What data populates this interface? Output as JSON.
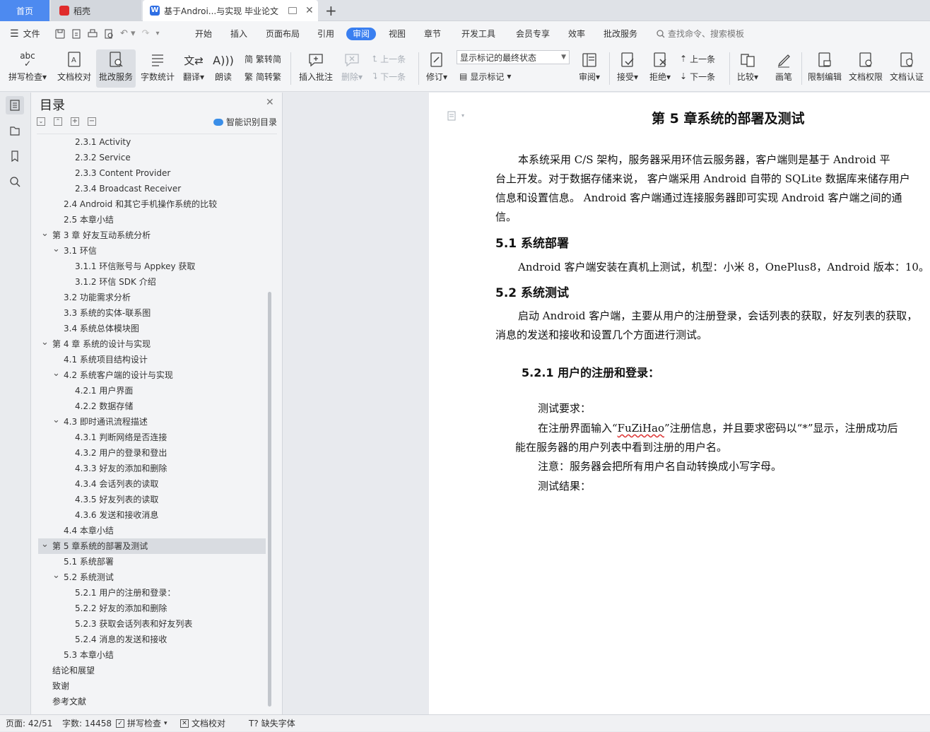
{
  "tabs": {
    "home": "首页",
    "daoke": "稻壳",
    "doc": "基于Androi...与实现 毕业论文",
    "new_tab": "+"
  },
  "menu": {
    "file": "文件",
    "items": [
      "开始",
      "插入",
      "页面布局",
      "引用",
      "审阅",
      "视图",
      "章节",
      "开发工具",
      "会员专享",
      "效率",
      "批改服务"
    ],
    "search_placeholder": "查找命令、搜索模板"
  },
  "ribbon": {
    "spell_check": "拼写检查",
    "doc_check": "文档校对",
    "correction_service": "批改服务",
    "word_count": "字数统计",
    "translate": "翻译",
    "read_aloud": "朗读",
    "trad_to_simp": "繁转简",
    "simp_to_trad": "简转繁",
    "insert_comment": "插入批注",
    "delete": "删除",
    "prev_comment": "上一条",
    "next_comment": "下一条",
    "revise": "修订",
    "markup_state": "显示标记的最终状态",
    "show_markup": "显示标记",
    "review": "审阅",
    "accept": "接受",
    "reject": "拒绝",
    "prev_change": "上一条",
    "next_change": "下一条",
    "compare": "比较",
    "pen": "画笔",
    "restrict_edit": "限制编辑",
    "doc_permission": "文档权限",
    "doc_certify": "文档认证"
  },
  "toc": {
    "title": "目录",
    "smart": "智能识别目录",
    "items": [
      {
        "text": "2.3.1 Activity",
        "level": 3
      },
      {
        "text": "2.3.2 Service",
        "level": 3
      },
      {
        "text": "2.3.3 Content Provider",
        "level": 3
      },
      {
        "text": "2.3.4 Broadcast Receiver",
        "level": 3
      },
      {
        "text": "2.4 Android 和其它手机操作系统的比较",
        "level": 2
      },
      {
        "text": "2.5 本章小结",
        "level": 2
      },
      {
        "text": "第 3 章  好友互动系统分析",
        "level": 1,
        "exp": true
      },
      {
        "text": "3.1 环信",
        "level": 2,
        "exp": true
      },
      {
        "text": "3.1.1 环信账号与 Appkey 获取",
        "level": 3
      },
      {
        "text": "3.1.2  环信  SDK 介绍",
        "level": 3
      },
      {
        "text": "3.2 功能需求分析",
        "level": 2
      },
      {
        "text": "3.3 系统的实体-联系图",
        "level": 2
      },
      {
        "text": "3.4 系统总体模块图",
        "level": 2
      },
      {
        "text": "第 4 章  系统的设计与实现",
        "level": 1,
        "exp": true
      },
      {
        "text": "4.1  系统项目结构设计",
        "level": 2
      },
      {
        "text": "4.2  系统客户端的设计与实现",
        "level": 2,
        "exp": true
      },
      {
        "text": "4.2.1 用户界面",
        "level": 3
      },
      {
        "text": "4.2.2  数据存储",
        "level": 3
      },
      {
        "text": "4.3 即时通讯流程描述",
        "level": 2,
        "exp": true
      },
      {
        "text": "4.3.1 判断网络是否连接",
        "level": 3
      },
      {
        "text": "4.3.2 用户的登录和登出",
        "level": 3
      },
      {
        "text": "4.3.3 好友的添加和删除",
        "level": 3
      },
      {
        "text": "4.3.4 会话列表的读取",
        "level": 3
      },
      {
        "text": "4.3.5 好友列表的读取",
        "level": 3
      },
      {
        "text": "4.3.6 发送和接收消息",
        "level": 3
      },
      {
        "text": "4.4 本章小结",
        "level": 2
      },
      {
        "text": "第 5 章系统的部署及测试",
        "level": 1,
        "exp": true,
        "selected": true
      },
      {
        "text": "5.1 系统部署",
        "level": 2
      },
      {
        "text": "5.2 系统测试",
        "level": 2,
        "exp": true
      },
      {
        "text": "5.2.1 用户的注册和登录：",
        "level": 3
      },
      {
        "text": "5.2.2 好友的添加和删除",
        "level": 3
      },
      {
        "text": "5.2.3 获取会话列表和好友列表",
        "level": 3
      },
      {
        "text": "5.2.4 消息的发送和接收",
        "level": 3
      },
      {
        "text": "5.3 本章小结",
        "level": 2
      },
      {
        "text": "结论和展望",
        "level": 1
      },
      {
        "text": "致谢",
        "level": 1
      },
      {
        "text": "参考文献",
        "level": 1
      }
    ]
  },
  "doc": {
    "chapter_title": "第 5 章系统的部署及测试",
    "intro_l1": "本系统采用  C/S  架构，服务器采用环信云服务器，客户端则是基于      Android     平",
    "intro_l2": "台上开发。对于数据存储来说，  客户端采用  Android  自带的  SQLite  数据库来储存用户",
    "intro_l3": "信息和设置信息。  Android  客户端通过连接服务器即可实现      Android  客户端之间的通",
    "intro_l4": "信。",
    "h_5_1": "5.1 系统部署",
    "deploy": "Android 客户端安装在真机上测试，机型：小米 8，OnePlus8，Android 版本：10。",
    "h_5_2": "5.2 系统测试",
    "test_l1": "启动 Android 客户端，主要从用户的注册登录，会话列表的获取，好友列表的获取，",
    "test_l2": "消息的发送和接收和设置几个方面进行测试。",
    "h_5_2_1": "5.2.1 用户的注册和登录：",
    "req": "测试要求：",
    "req_l1_a": "在注册界面输入“",
    "req_l1_name": "FuZiHao",
    "req_l1_b": "”注册信息，并且要求密码以“*”显示，注册成功后",
    "req_l2": "能在服务器的用户列表中看到注册的用户名。",
    "note": "注意：服务器会把所有用户名自动转换成小写字母。",
    "result": "测试结果："
  },
  "status": {
    "page": "页面: 42/51",
    "words": "字数: 14458",
    "spell": "拼写检查",
    "check": "文档校对",
    "missing_font": "缺失字体"
  },
  "colors": {
    "accent": "#3a7ff0",
    "tab_home": "#4d8af0",
    "wps_red": "#e02b2b",
    "doc_blue": "#2f6fe4"
  }
}
